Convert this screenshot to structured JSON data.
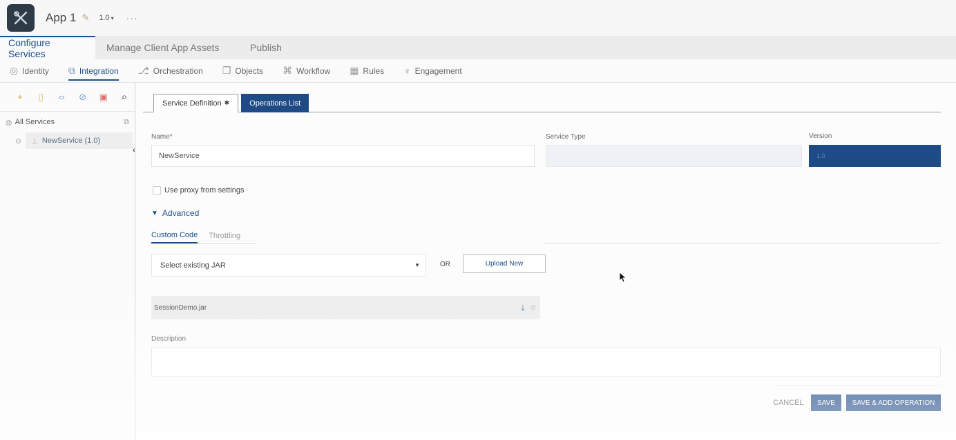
{
  "app": {
    "title": "App 1",
    "version": "1.0",
    "more": "···"
  },
  "main_tabs": [
    "Configure Services",
    "Manage Client App Assets",
    "Publish"
  ],
  "sub_nav": [
    {
      "label": "Identity",
      "icon": "fingerprint-icon"
    },
    {
      "label": "Integration",
      "icon": "integration-icon"
    },
    {
      "label": "Orchestration",
      "icon": "orchestration-icon"
    },
    {
      "label": "Objects",
      "icon": "objects-icon"
    },
    {
      "label": "Workflow",
      "icon": "workflow-icon"
    },
    {
      "label": "Rules",
      "icon": "rules-icon"
    },
    {
      "label": "Engagement",
      "icon": "engagement-icon"
    }
  ],
  "sidebar": {
    "all_services": "All Services",
    "service_item": "NewService (1.0)"
  },
  "editor_tabs": {
    "definition": "Service Definition",
    "operations": "Operations List"
  },
  "form": {
    "name_label": "Name*",
    "name_value": "NewService",
    "service_type_label": "Service Type",
    "service_type_value": "",
    "version_label": "Version",
    "version_value": "1.0",
    "proxy_label": "Use proxy from settings",
    "advanced_label": "Advanced",
    "custom_code_tab": "Custom Code",
    "throttling_tab": "Throttling",
    "select_jar": "Select existing JAR",
    "or": "OR",
    "upload_new": "Upload New",
    "jar_file": "SessionDemo.jar",
    "description_label": "Description",
    "description_value": ""
  },
  "actions": {
    "cancel": "CANCEL",
    "save": "SAVE",
    "save_add": "SAVE & ADD OPERATION"
  },
  "colors": {
    "accent": "#1e4a86",
    "link": "#1c4f8a"
  }
}
